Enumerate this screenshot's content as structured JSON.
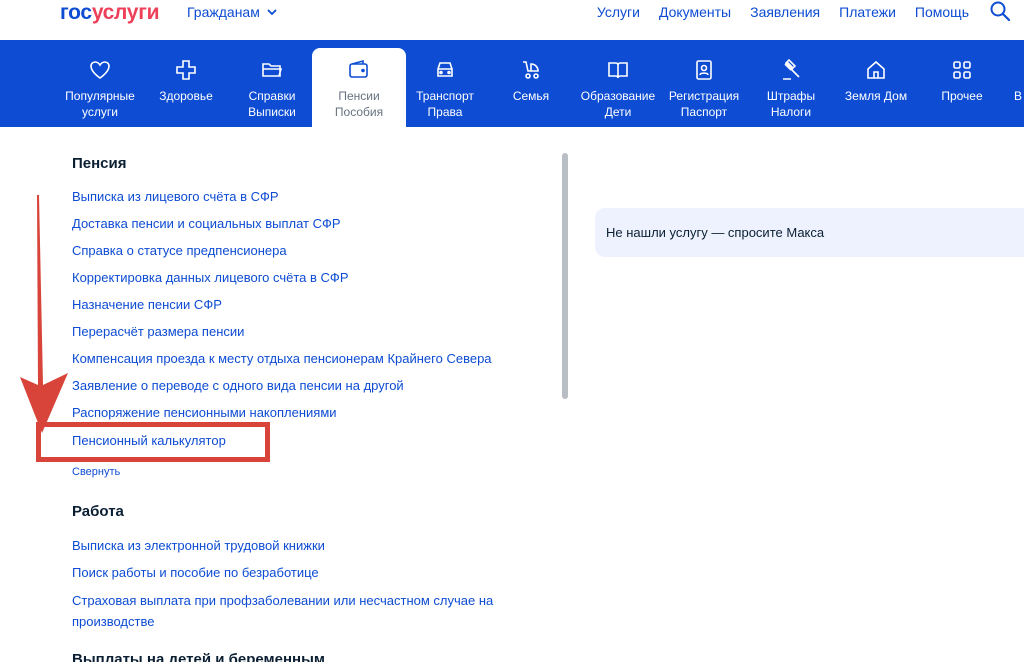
{
  "header": {
    "logo_part1": "гос",
    "logo_part2": "услуги",
    "audience": "Гражданам",
    "nav": [
      "Услуги",
      "Документы",
      "Заявления",
      "Платежи",
      "Помощь"
    ]
  },
  "categories": [
    {
      "line1": "Популярные",
      "line2": "услуги",
      "icon": "heart-icon"
    },
    {
      "line1": "Здоровье",
      "line2": "",
      "icon": "health-cross-icon"
    },
    {
      "line1": "Справки",
      "line2": "Выписки",
      "icon": "folder-icon"
    },
    {
      "line1": "Пенсии",
      "line2": "Пособия",
      "icon": "wallet-icon"
    },
    {
      "line1": "Транспорт",
      "line2": "Права",
      "icon": "car-icon"
    },
    {
      "line1": "Семья",
      "line2": "",
      "icon": "stroller-icon"
    },
    {
      "line1": "Образование",
      "line2": "Дети",
      "icon": "book-icon"
    },
    {
      "line1": "Регистрация",
      "line2": "Паспорт",
      "icon": "passport-icon"
    },
    {
      "line1": "Штрафы",
      "line2": "Налоги",
      "icon": "gavel-icon"
    },
    {
      "line1": "Земля Дом",
      "line2": "",
      "icon": "house-icon"
    },
    {
      "line1": "Прочее",
      "line2": "",
      "icon": "grid-icon"
    },
    {
      "line1": "В",
      "line2": "",
      "icon": ""
    }
  ],
  "pension": {
    "title": "Пенсия",
    "links": [
      "Выписка из лицевого счёта в СФР",
      "Доставка пенсии и социальных выплат СФР",
      "Справка о статусе предпенсионера",
      "Корректировка данных лицевого счёта в СФР",
      "Назначение пенсии СФР",
      "Перерасчёт размера пенсии",
      "Компенсация проезда к месту отдыха пенсионерам Крайнего Севера",
      "Заявление о переводе с одного вида пенсии на другой",
      "Распоряжение пенсионными накоплениями",
      "Пенсионный калькулятор"
    ],
    "collapse": "Свернуть"
  },
  "work": {
    "title": "Работа",
    "links": [
      "Выписка из электронной трудовой книжки",
      "Поиск работы и пособие по безработице",
      "Страховая выплата при профзаболевании или несчастном случае на производстве"
    ]
  },
  "children": {
    "title": "Выплаты на детей и беременным"
  },
  "ask": {
    "text": "Не нашли услугу — спросите Макса"
  },
  "colors": {
    "brand_blue": "#0d4cd3",
    "brand_red": "#ee3f58",
    "annotation_red": "#d9443a"
  }
}
